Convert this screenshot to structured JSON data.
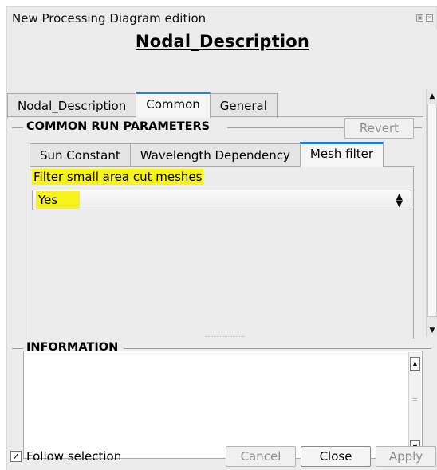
{
  "window": {
    "title": "New Processing Diagram edition"
  },
  "heading": "Nodal_Description",
  "outer_tabs": [
    {
      "label": "Nodal_Description",
      "active": false
    },
    {
      "label": "Common",
      "active": true
    },
    {
      "label": "General",
      "active": false
    }
  ],
  "common_group": {
    "title": "COMMON RUN PARAMETERS",
    "revert_label": "Revert"
  },
  "inner_tabs": [
    {
      "label": "Sun Constant",
      "active": false
    },
    {
      "label": "Wavelength Dependency",
      "active": false
    },
    {
      "label": "Mesh filter",
      "active": true
    }
  ],
  "mesh_filter": {
    "label": "Filter small area cut meshes",
    "value": "Yes"
  },
  "information": {
    "title": "INFORMATION",
    "text": ""
  },
  "footer": {
    "follow_selection_label": "Follow selection",
    "follow_selection_checked": true,
    "cancel_label": "Cancel",
    "close_label": "Close",
    "apply_label": "Apply"
  },
  "colors": {
    "highlight": "#f7f21a",
    "active_tab_accent": "#2a7fd4"
  },
  "icons": {
    "combo_arrow": "up-down-arrows-icon",
    "scroll_up": "scroll-up-arrow-icon",
    "scroll_down": "scroll-down-arrow-icon"
  }
}
